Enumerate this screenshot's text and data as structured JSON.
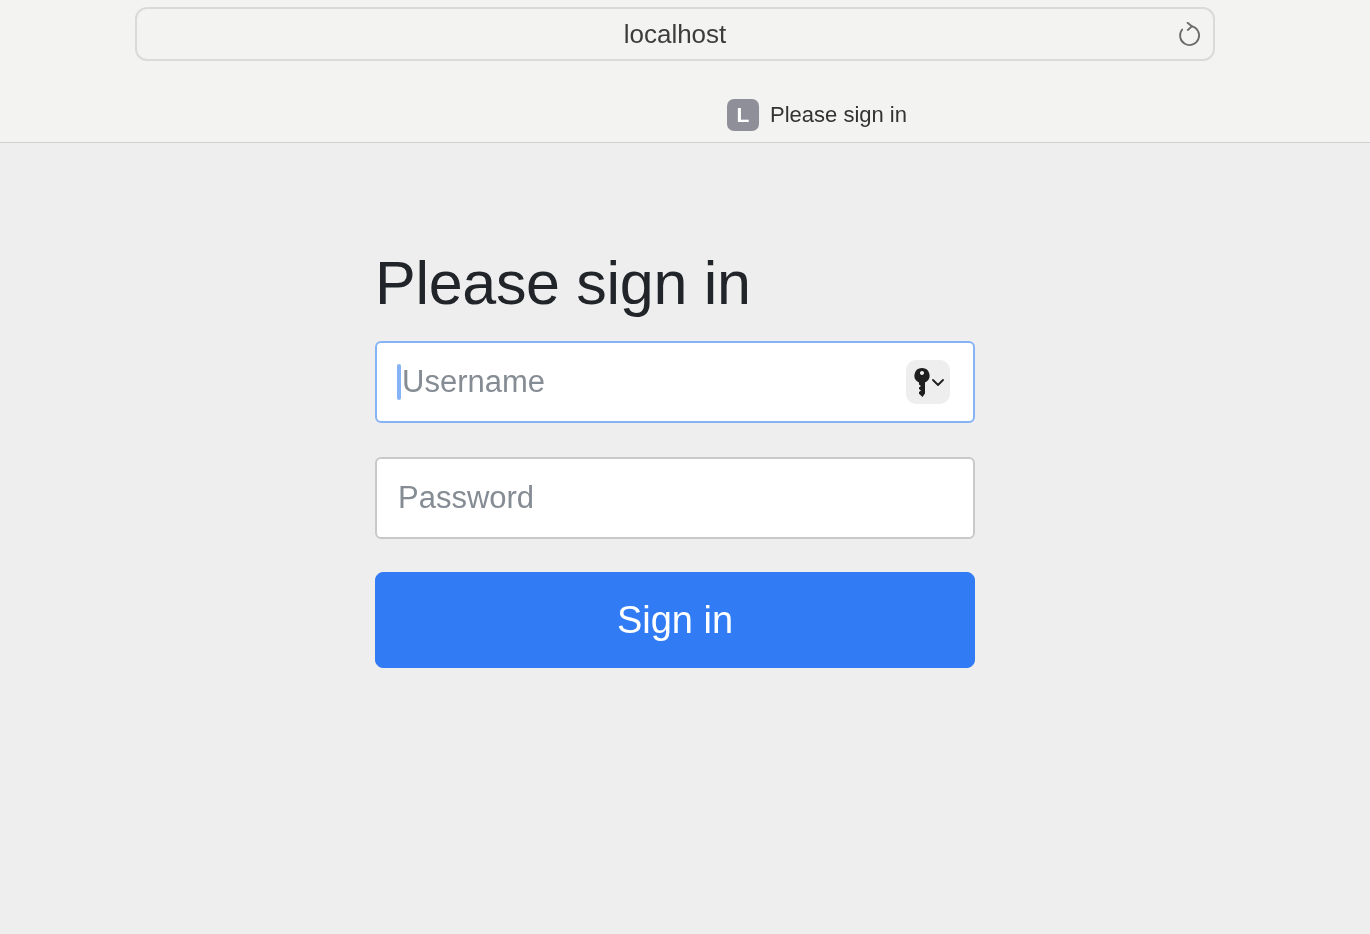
{
  "browser": {
    "address": "localhost",
    "tab": {
      "favicon": "L",
      "title": "Please sign in"
    }
  },
  "heading": "Please sign in",
  "fields": [
    {
      "placeholder": "Username",
      "focused": true,
      "autofill_button": true
    },
    {
      "placeholder": "Password",
      "focused": false,
      "autofill_button": false
    }
  ],
  "submit_button": "Sign in"
}
